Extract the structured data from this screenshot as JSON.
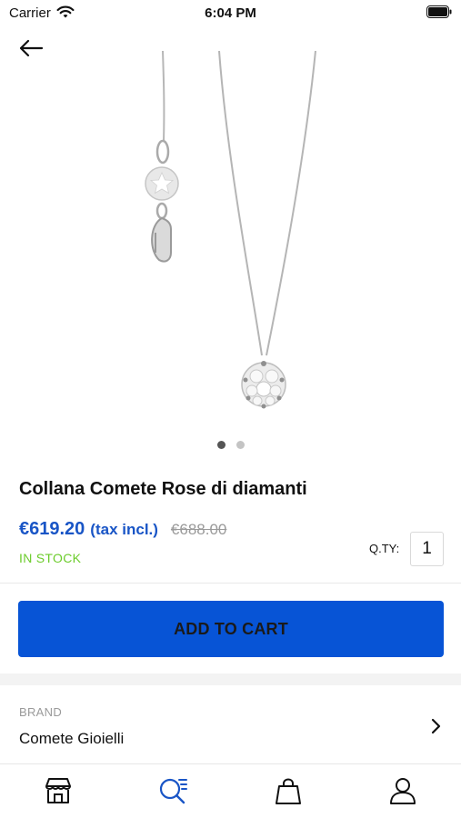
{
  "status_bar": {
    "carrier": "Carrier",
    "time": "6:04 PM"
  },
  "icons": {
    "back": "arrow-left-icon",
    "wifi": "wifi-icon",
    "battery": "battery-icon",
    "chevron": "chevron-right-icon"
  },
  "gallery": {
    "image": "necklace with diamond flower pendant",
    "page_count": 2,
    "active_page": 1
  },
  "product": {
    "name": "Collana Comete Rose di diamanti",
    "price": "€619.20",
    "tax_note": "(tax incl.)",
    "old_price": "€688.00",
    "stock": "IN STOCK",
    "qty_label": "Q.TY:",
    "qty_value": "1"
  },
  "actions": {
    "add_to_cart": "ADD TO CART"
  },
  "brand": {
    "label": "BRAND",
    "value": "Comete Gioielli"
  },
  "tabs": [
    {
      "name": "store-icon",
      "active": false
    },
    {
      "name": "search-icon",
      "active": true
    },
    {
      "name": "bag-icon",
      "active": false
    },
    {
      "name": "user-icon",
      "active": false
    }
  ],
  "colors": {
    "accent": "#1955c6",
    "button": "#0754d6",
    "in_stock": "#6ccc2c"
  }
}
